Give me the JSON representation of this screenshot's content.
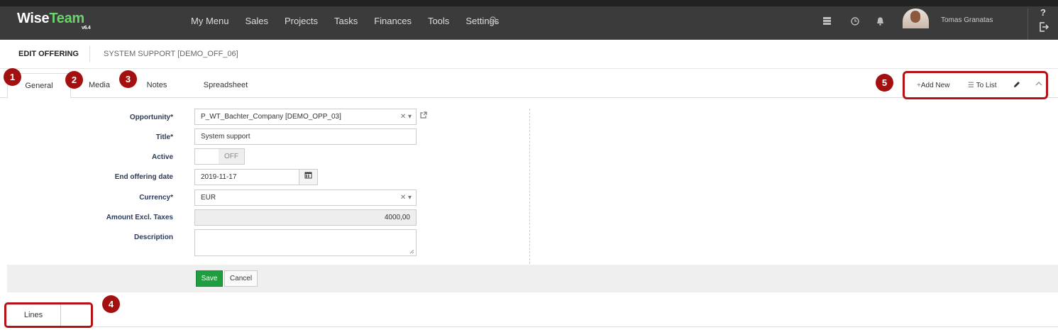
{
  "app": {
    "logo_main": "Wise",
    "logo_accent": "Team",
    "version": "v6.4"
  },
  "nav": {
    "items": [
      "My Menu",
      "Sales",
      "Projects",
      "Tasks",
      "Finances",
      "Tools",
      "Settings"
    ],
    "user_name": "Tomas Granatas"
  },
  "header": {
    "title": "EDIT OFFERING",
    "subtitle": "SYSTEM SUPPORT [DEMO_OFF_06]"
  },
  "tabs": [
    "General",
    "Media",
    "Notes",
    "Spreadsheet"
  ],
  "badges": [
    "1",
    "2",
    "3",
    "4",
    "5"
  ],
  "actions": {
    "add_new": "Add New",
    "to_list": "To List"
  },
  "form": {
    "opportunity_label": "Opportunity*",
    "opportunity_value": "P_WT_Bachter_Company [DEMO_OPP_03]",
    "title_label": "Title*",
    "title_value": "System support",
    "active_label": "Active",
    "active_value": "OFF",
    "end_date_label": "End offering date",
    "end_date_value": "2019-11-17",
    "currency_label": "Currency*",
    "currency_value": "EUR",
    "amount_label": "Amount Excl. Taxes",
    "amount_value": "4000,00",
    "description_label": "Description",
    "description_value": ""
  },
  "buttons": {
    "save": "Save",
    "cancel": "Cancel"
  },
  "lines_tab": "Lines",
  "colors": {
    "accent_green": "#1e9e3f",
    "badge_red": "#a40f0f",
    "highlight_red": "#b31217",
    "topbar": "#3b3b3b"
  }
}
